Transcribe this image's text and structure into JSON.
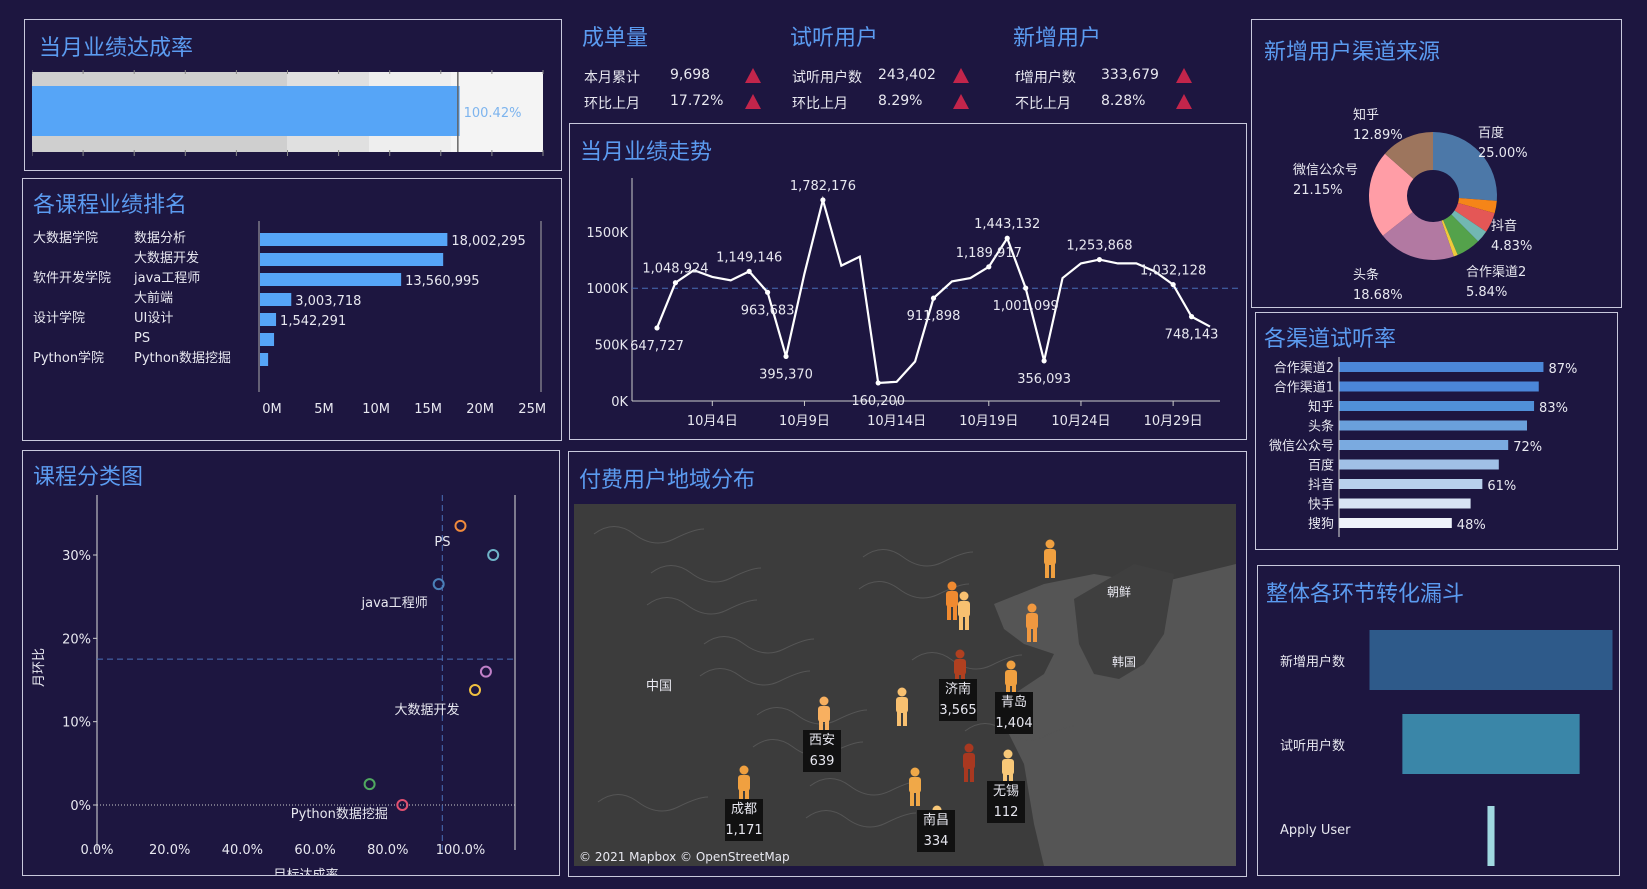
{
  "panels": {
    "achievement": {
      "title": "当月业绩达成率",
      "rate_label": "100.42%",
      "rate": 1.0042
    },
    "course_rank": {
      "title": "各课程业绩排名"
    },
    "trend": {
      "title": "当月业绩走势"
    },
    "course_class": {
      "title": "课程分类图"
    },
    "region": {
      "title": "付费用户地域分布",
      "attribution": "© 2021 Mapbox © OpenStreetMap",
      "country_label": "中国",
      "korea_label": "朝鲜",
      "south_korea_label": "韩国"
    },
    "channel_source": {
      "title": "新增用户渠道来源"
    },
    "trial_rate": {
      "title": "各渠道试听率"
    },
    "funnel": {
      "title": "整体各环节转化漏斗"
    }
  },
  "kpis": [
    {
      "title": "成单量",
      "rows": [
        {
          "label": "本月累计",
          "value": "9,698"
        },
        {
          "label": "环比上月",
          "value": "17.72%"
        }
      ]
    },
    {
      "title": "试听用户",
      "rows": [
        {
          "label": "试听用户数",
          "value": "243,402"
        },
        {
          "label": "环比上月",
          "value": "8.29%"
        }
      ]
    },
    {
      "title": "新增用户",
      "rows": [
        {
          "label": "f增用户数",
          "value": "333,679"
        },
        {
          "label": "不比上月",
          "value": "8.28%"
        }
      ]
    }
  ],
  "colors": {
    "accent": "#5b9bf0",
    "bar": "#56a5f7",
    "up_triangle": "#c2254b",
    "background": "#1d1640"
  },
  "chart_data": [
    {
      "id": "course_rank",
      "type": "bar",
      "orientation": "horizontal",
      "groups": [
        "大数据学院",
        "",
        "软件开发学院",
        "",
        "设计学院",
        "",
        "Python学院"
      ],
      "categories": [
        "数据分析",
        "大数据开发",
        "java工程师",
        "大前端",
        "UI设计",
        "PS",
        "Python数据挖掘"
      ],
      "values": [
        18002295,
        17600000,
        13560995,
        3003718,
        1542291,
        1350000,
        780000
      ],
      "value_labels": [
        "18,002,295",
        "",
        "13,560,995",
        "3,003,718",
        "1,542,291",
        "",
        ""
      ],
      "xticks": [
        "0M",
        "5M",
        "10M",
        "15M",
        "20M",
        "25M"
      ],
      "xlim": [
        0,
        27000000
      ]
    },
    {
      "id": "trend",
      "type": "line",
      "x_start": "10月1日",
      "values": [
        647727,
        1048924,
        1160000,
        1100000,
        1070000,
        1149146,
        963683,
        395370,
        1130000,
        1782176,
        1200000,
        1280000,
        160200,
        170000,
        350000,
        911898,
        1060000,
        1090000,
        1189917,
        1443132,
        1001099,
        356093,
        1090000,
        1220000,
        1253868,
        1220000,
        1220000,
        1150000,
        1032128,
        748143,
        660000
      ],
      "data_labels": [
        {
          "i": 0,
          "text": "647,727"
        },
        {
          "i": 1,
          "text": "1,048,924"
        },
        {
          "i": 5,
          "text": "1,149,146"
        },
        {
          "i": 6,
          "text": "963,683"
        },
        {
          "i": 7,
          "text": "395,370"
        },
        {
          "i": 9,
          "text": "1,782,176"
        },
        {
          "i": 12,
          "text": "160,200"
        },
        {
          "i": 15,
          "text": "911,898"
        },
        {
          "i": 18,
          "text": "1,189,917"
        },
        {
          "i": 19,
          "text": "1,443,132"
        },
        {
          "i": 20,
          "text": "1,001,099"
        },
        {
          "i": 21,
          "text": "356,093"
        },
        {
          "i": 24,
          "text": "1,253,868"
        },
        {
          "i": 28,
          "text": "1,032,128"
        },
        {
          "i": 29,
          "text": "748,143"
        }
      ],
      "yticks": [
        "0K",
        "500K",
        "1000K",
        "1500K"
      ],
      "xticks": [
        "10月4日",
        "10月9日",
        "10月14日",
        "10月19日",
        "10月24日",
        "10月29日"
      ],
      "reference": 1000000,
      "ylim": [
        0,
        1800000
      ]
    },
    {
      "id": "course_class",
      "type": "scatter",
      "xlabel": "目标达成率",
      "ylabel": "月环比",
      "xticks": [
        "0.0%",
        "20.0%",
        "40.0%",
        "60.0%",
        "80.0%",
        "100.0%"
      ],
      "yticks": [
        "0%",
        "10%",
        "20%",
        "30%"
      ],
      "xlim": [
        0,
        115
      ],
      "ylim": [
        -3,
        36
      ],
      "ref_x": 95,
      "ref_y": 17.5,
      "points": [
        {
          "x": 100,
          "y": 33.5,
          "label": "PS",
          "color": "#f08a3c"
        },
        {
          "x": 109,
          "y": 30,
          "label": "",
          "color": "#6fb3c8"
        },
        {
          "x": 94,
          "y": 26.5,
          "label": "java工程师",
          "color": "#4a7fb8"
        },
        {
          "x": 107,
          "y": 16,
          "label": "",
          "color": "#c080c8"
        },
        {
          "x": 104,
          "y": 13.8,
          "label": "大数据开发",
          "color": "#f0c040"
        },
        {
          "x": 75,
          "y": 2.5,
          "label": "",
          "color": "#50a860"
        },
        {
          "x": 84,
          "y": 0,
          "label": "Python数据挖掘",
          "color": "#e05070"
        }
      ]
    },
    {
      "id": "channel_source",
      "type": "pie",
      "slices": [
        {
          "label": "百度",
          "value": 25.0,
          "text": "25.00%",
          "color": "#4c78a8"
        },
        {
          "label": "",
          "value": 3.0,
          "text": "",
          "color": "#f58518"
        },
        {
          "label": "抖音",
          "value": 4.83,
          "text": "4.83%",
          "color": "#e45756"
        },
        {
          "label": "",
          "value": 3.0,
          "text": "",
          "color": "#72b7b2"
        },
        {
          "label": "合作渠道2",
          "value": 5.84,
          "text": "5.84%",
          "color": "#54a24b"
        },
        {
          "label": "",
          "value": 1.0,
          "text": "",
          "color": "#eeca3b"
        },
        {
          "label": "头条",
          "value": 18.68,
          "text": "18.68%",
          "color": "#b279a2"
        },
        {
          "label": "微信公众号",
          "value": 21.15,
          "text": "21.15%",
          "color": "#ff9da6"
        },
        {
          "label": "知乎",
          "value": 12.89,
          "text": "12.89%",
          "color": "#9d755d"
        }
      ]
    },
    {
      "id": "trial_rate",
      "type": "bar",
      "orientation": "horizontal",
      "categories": [
        "合作渠道2",
        "合作渠道1",
        "知乎",
        "头条",
        "微信公众号",
        "百度",
        "抖音",
        "快手",
        "搜狗"
      ],
      "values": [
        87,
        85,
        83,
        80,
        72,
        68,
        61,
        56,
        48
      ],
      "value_labels": [
        "87%",
        "",
        "83%",
        "",
        "72%",
        "",
        "61%",
        "",
        "48%"
      ],
      "colors": [
        "#4b86d8",
        "#4b86d8",
        "#5090d8",
        "#6aa0dc",
        "#7aaae0",
        "#a0c0e6",
        "#b8d0ec",
        "#d8e4f4",
        "#eef2fa"
      ],
      "xlim": [
        0,
        100
      ]
    },
    {
      "id": "funnel",
      "type": "bar",
      "categories": [
        "新增用户数",
        "试听用户数",
        "Apply User"
      ],
      "values": [
        333679,
        243402,
        9698
      ],
      "colors": [
        "#2e5a8a",
        "#3a86a8",
        "#a0d8e0"
      ]
    }
  ],
  "map_points": [
    {
      "city": "",
      "count": "",
      "color": "#f0a040"
    },
    {
      "city": "",
      "count": "",
      "color": "#f08a30"
    },
    {
      "city": "",
      "count": "",
      "color": "#f8c070"
    },
    {
      "city": "",
      "count": "",
      "color": "#f09840"
    },
    {
      "city": "济南",
      "count": "3,565",
      "color": "#b04020"
    },
    {
      "city": "青岛",
      "count": "1,404",
      "color": "#f0a040"
    },
    {
      "city": "西安",
      "count": "639",
      "color": "#f8b060"
    },
    {
      "city": "",
      "count": "",
      "color": "#f8c070"
    },
    {
      "city": "",
      "count": "",
      "color": "#a83820"
    },
    {
      "city": "无锡",
      "count": "112",
      "color": "#f8c878"
    },
    {
      "city": "成都",
      "count": "1,171",
      "color": "#f0a040"
    },
    {
      "city": "",
      "count": "",
      "color": "#f0a848"
    },
    {
      "city": "南昌",
      "count": "334",
      "color": "#f8c878"
    }
  ]
}
